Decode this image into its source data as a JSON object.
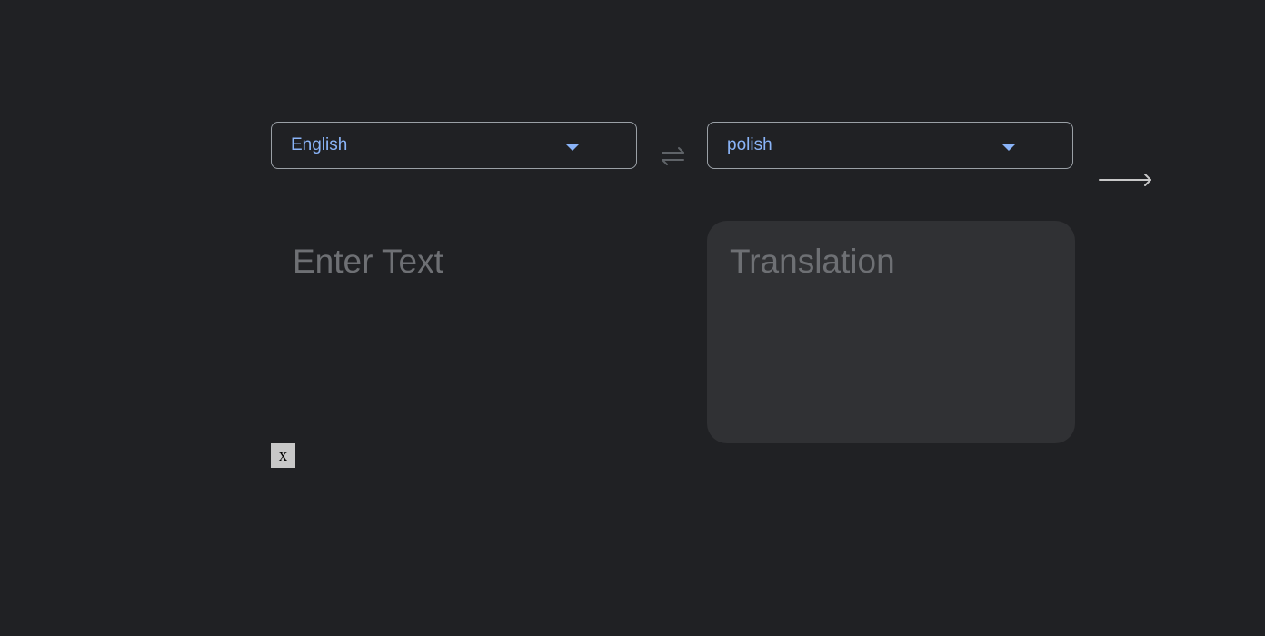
{
  "source_language": {
    "label": "English",
    "icon": "caret-down-icon"
  },
  "target_language": {
    "label": "polish",
    "icon": "caret-down-icon"
  },
  "swap": {
    "icon": "swap-arrows-icon"
  },
  "translate": {
    "icon": "right-arrow-icon"
  },
  "source_text": {
    "value": "",
    "placeholder": "Enter Text"
  },
  "translation": {
    "placeholder": "Translation"
  },
  "clear": {
    "label": "x"
  },
  "colors": {
    "background": "#202124",
    "accent": "#8ab4f8",
    "panel": "#303134",
    "placeholder": "#6e7074",
    "border": "#9aa0a6"
  }
}
